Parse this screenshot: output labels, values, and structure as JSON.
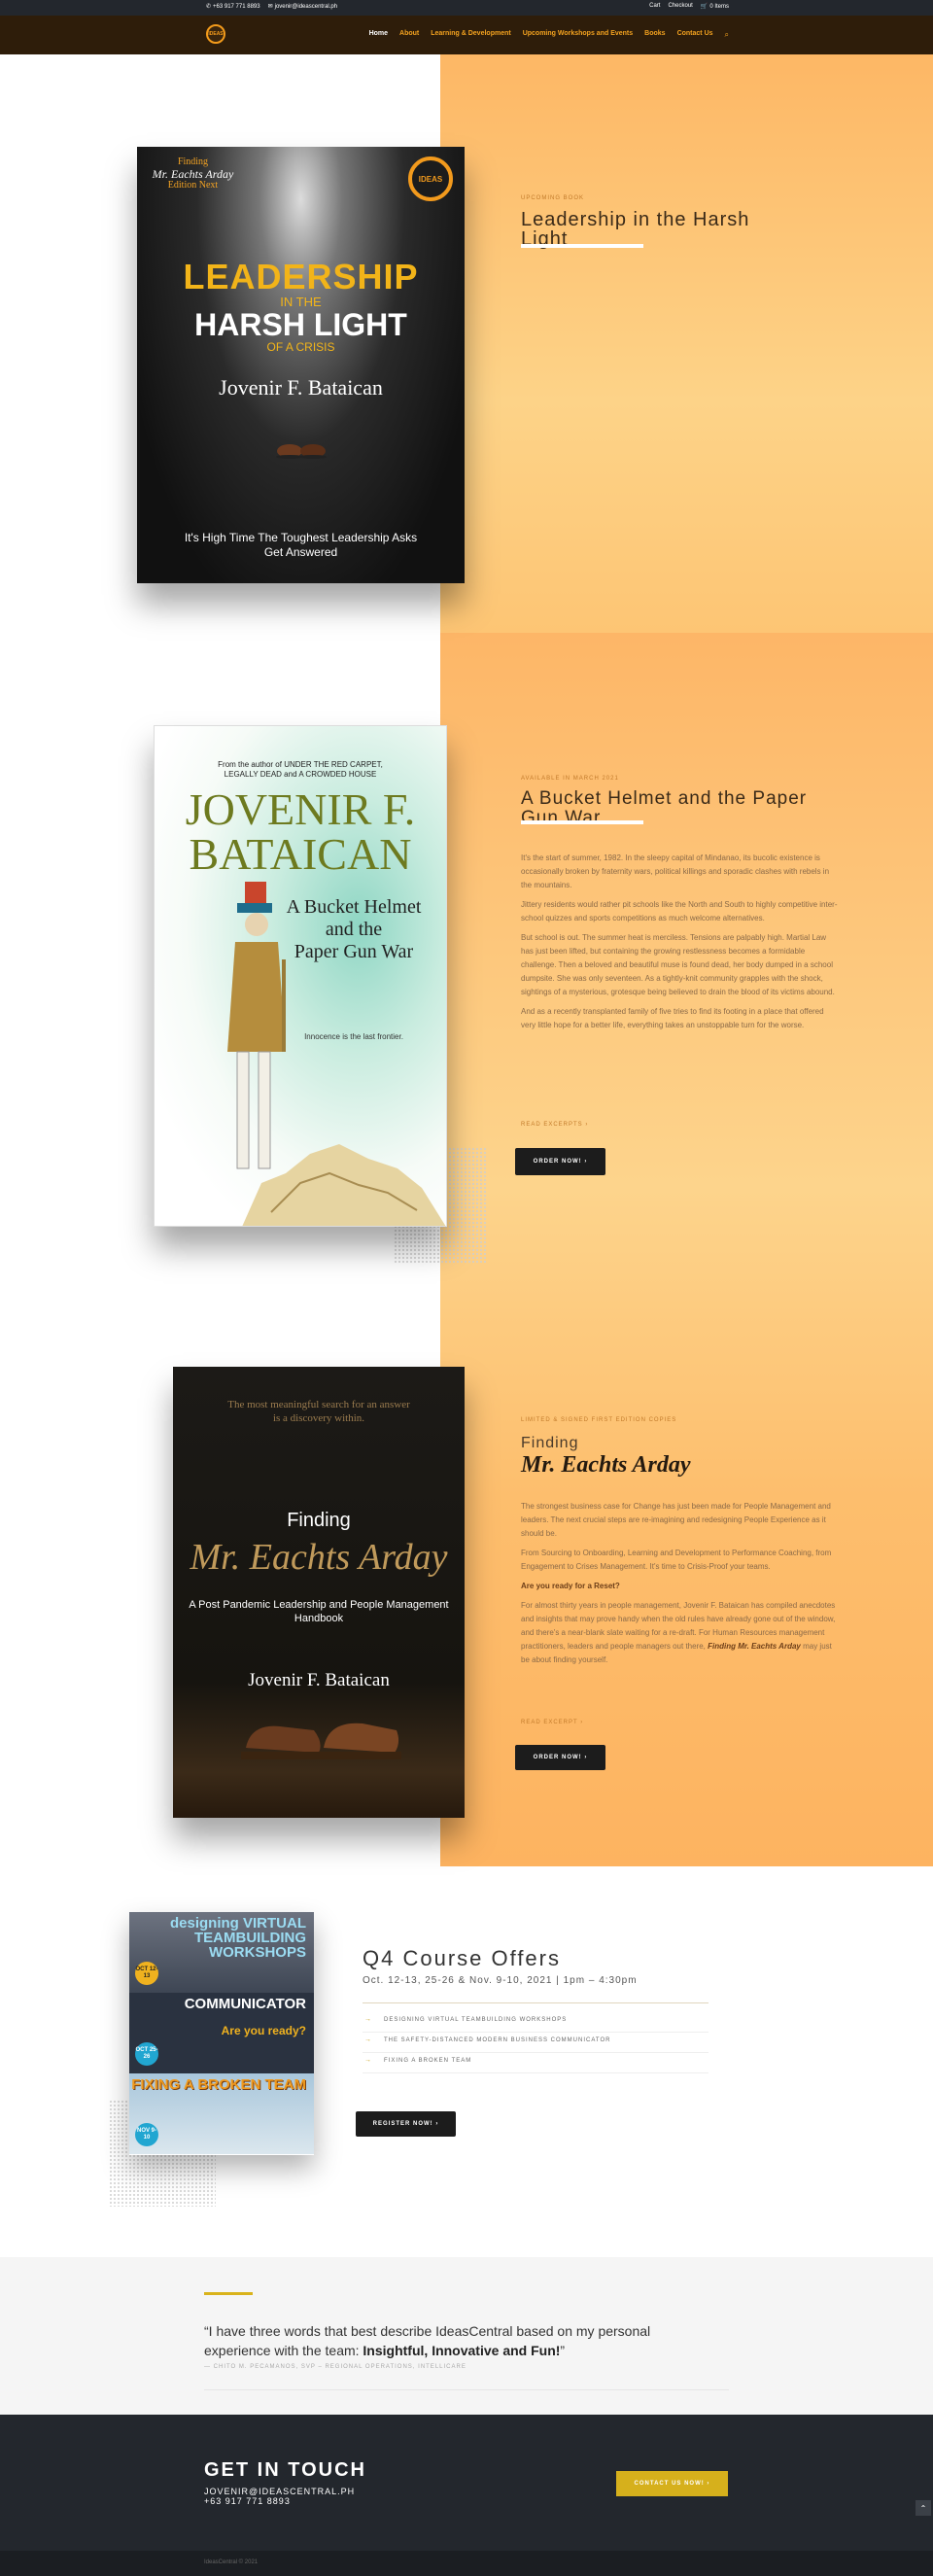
{
  "topbar": {
    "phone": "+63 917 771 8893",
    "email": "jovenir@ideascentral.ph",
    "cart": "Cart",
    "checkout": "Checkout",
    "items": "0 Items"
  },
  "nav": {
    "logo_text": "IDEAS",
    "items": [
      "Home",
      "About",
      "Learning & Development",
      "Upcoming Workshops and Events",
      "Books",
      "Contact Us"
    ]
  },
  "book1": {
    "eyebrow": "UPCOMING BOOK",
    "title": "Leadership in the Harsh Light",
    "cover": {
      "finding": "Finding",
      "signature": "Mr. Eachts Arday",
      "edition": "Edition Next",
      "badge": "IDEAS",
      "line1": "LEADERSHIP",
      "line2": "IN THE",
      "line3": "HARSH LIGHT",
      "line4": "OF A CRISIS",
      "author": "Jovenir F. Bataican",
      "tagline1": "It's High Time The Toughest Leadership Asks",
      "tagline2": "Get Answered"
    }
  },
  "book2": {
    "eyebrow": "AVAILABLE IN MARCH 2021",
    "title": "A Bucket Helmet and the Paper Gun War",
    "paragraphs": [
      "It's the start of summer, 1982. In the sleepy capital of Mindanao, its bucolic existence is occasionally broken by fraternity wars, political killings and sporadic clashes with rebels in the mountains.",
      "Jittery residents would rather pit schools like the North and South to highly competitive inter-school quizzes and sports competitions as much welcome alternatives.",
      "But school is out. The summer heat is merciless. Tensions are palpably high. Martial Law has just been lifted, but containing the growing restlessness becomes a formidable challenge. Then a beloved and beautiful muse is found dead, her body dumped in a school dumpsite. She was only seventeen. As a tightly-knit community grapples with the shock, sightings of a mysterious, grotesque being believed to drain the blood of its victims abound.",
      "And as a recently transplanted family of five tries to find its footing in a place that offered very little hope for a better life, everything takes an unstoppable turn for the worse."
    ],
    "read_link": "READ EXCERPTS",
    "order_button": "ORDER NOW!",
    "cover": {
      "from_line1": "From the author of UNDER THE RED CARPET,",
      "from_line2": "LEGALLY DEAD and A CROWDED HOUSE",
      "name1": "JOVENIR F.",
      "name2": "BATAICAN",
      "title1": "A Bucket Helmet",
      "title2": "and the",
      "title3": "Paper Gun War",
      "line": "Innocence is the last frontier."
    }
  },
  "book3": {
    "eyebrow": "LIMITED & SIGNED FIRST EDITION COPIES",
    "title_a": "Finding",
    "title_b": "Mr. Eachts Arday",
    "paragraphs": [
      "The strongest business case for Change has just been made for People Management and leaders. The next crucial steps are re-imagining and redesigning People Experience as it should be.",
      "From Sourcing to Onboarding, Learning and Development to Performance Coaching, from Engagement to Crises Management. It's time to Crisis-Proof your teams."
    ],
    "bold_line": "Are you ready for a Reset?",
    "last_paragraph": "For almost thirty years in people management, Jovenir F. Bataican has compiled anecdotes and insights that may prove handy when the old rules have already gone out of the window, and there's a near-blank slate waiting for a re-draft. For Human Resources management practitioners, leaders and people managers out there,",
    "last_em": "Finding Mr. Eachts Arday",
    "last_tail": "may just be about finding yourself.",
    "read_link": "READ EXCERPT",
    "order_button": "ORDER NOW!",
    "cover": {
      "quote1": "The most meaningful search for an answer",
      "quote2": "is a discovery within.",
      "finding": "Finding",
      "mr": "Mr. Eachts Arday",
      "sub1": "A Post Pandemic Leadership and People Management",
      "sub2": "Handbook",
      "author": "Jovenir F. Bataican"
    }
  },
  "courses": {
    "title": "Q4 Course Offers",
    "dates": "Oct. 12-13, 25-26 & Nov. 9-10, 2021 | 1pm – 4:30pm",
    "items": [
      "DESIGNING VIRTUAL TEAMBUILDING WORKSHOPS",
      "THE SAFETY-DISTANCED MODERN BUSINESS COMMUNICATOR",
      "FIXING A BROKEN TEAM"
    ],
    "register_button": "REGISTER NOW!",
    "panel1_head": "designing VIRTUAL TEAMBUILDING WORKSHOPS",
    "panel1_date": "OCT 12-13",
    "panel2_head": "COMMUNICATOR",
    "panel2_sub": "Are you ready?",
    "panel2_date": "OCT 25-26",
    "panel3_head": "FIXING A BROKEN TEAM",
    "panel3_date": "NOV 9-10"
  },
  "testimonial": {
    "quote_start": "“I have three words that best describe IdeasCentral based on my personal experience with the team: ",
    "quote_bold": "Insightful, Innovative and Fun!",
    "quote_end": "”",
    "who": "— CHITO M. PECAMANOS, SVP – REGIONAL OPERATIONS, INTELLICARE"
  },
  "footer": {
    "heading": "GET IN TOUCH",
    "email": "JOVENIR@IDEASCENTRAL.PH",
    "phone": "+63 917 771 8893",
    "contact_button": "CONTACT US NOW!",
    "copyright": "IdeasCentral © 2021"
  }
}
